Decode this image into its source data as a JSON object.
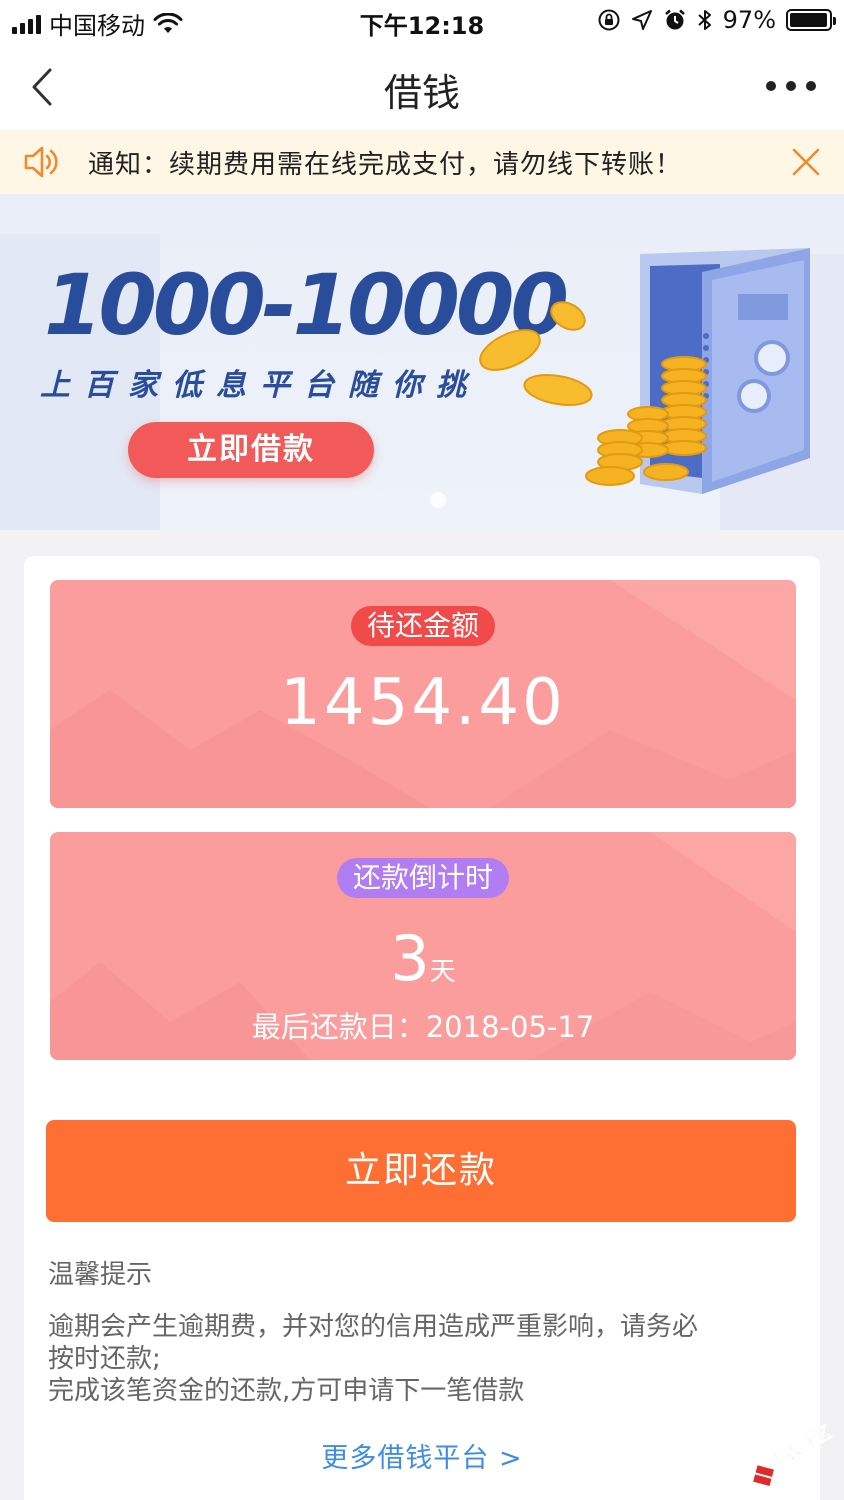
{
  "status_bar": {
    "carrier": "中国移动",
    "time": "下午12:18",
    "battery_text": "97%",
    "battery_level": 0.97
  },
  "nav": {
    "title": "借钱",
    "back_icon": "chevron-left-icon",
    "more_icon": "more-dots-icon"
  },
  "notice": {
    "text": "通知：续期费用需在线完成支付，请勿线下转账！",
    "icon": "speaker-icon",
    "close_icon": "close-icon",
    "color": "#f08a2c"
  },
  "banner": {
    "amount_range": "1000-10000",
    "subtitle": "上百家低息平台随你挑",
    "button_label": "立即借款"
  },
  "amount_panel": {
    "label": "待还金额",
    "value": "1454.40"
  },
  "countdown_panel": {
    "label": "还款倒计时",
    "days": "3",
    "days_unit": "天",
    "due_label": "最后还款日：",
    "due_date": "2018-05-17"
  },
  "repay_button": {
    "label": "立即还款",
    "color": "#ff6f33"
  },
  "tips": {
    "title": "温馨提示",
    "lines": [
      "逾期会产生逾期费，并对您的信用造成严重影响，请务必",
      "按时还款;",
      "完成该笔资金的还款,方可申请下一笔借款"
    ]
  },
  "more_link": {
    "label": "更多借钱平台 >"
  },
  "watermark": {
    "text": "卡农社区"
  }
}
